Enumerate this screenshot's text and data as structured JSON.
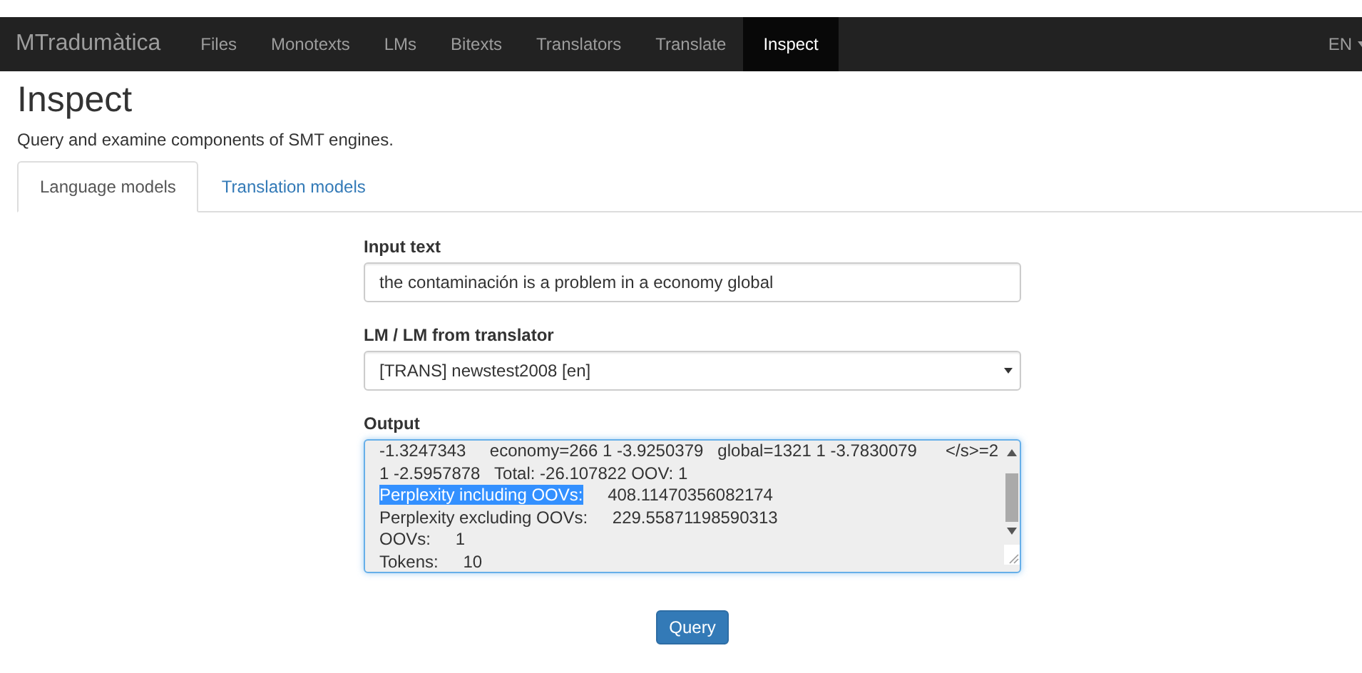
{
  "navbar": {
    "brand": "MTradumàtica",
    "items": [
      {
        "label": "Files",
        "selected": false
      },
      {
        "label": "Monotexts",
        "selected": false
      },
      {
        "label": "LMs",
        "selected": false
      },
      {
        "label": "Bitexts",
        "selected": false
      },
      {
        "label": "Translators",
        "selected": false
      },
      {
        "label": "Translate",
        "selected": false
      },
      {
        "label": "Inspect",
        "selected": true
      }
    ],
    "language": "EN"
  },
  "page": {
    "title": "Inspect",
    "subtitle": "Query and examine components of SMT engines."
  },
  "tabs": [
    {
      "label": "Language models",
      "selected": true
    },
    {
      "label": "Translation models",
      "selected": false
    }
  ],
  "form": {
    "input_label": "Input text",
    "input_value": "the contaminación is a problem in a economy global",
    "select_label": "LM / LM from translator",
    "select_value": "[TRANS] newstest2008 [en]",
    "output_label": "Output",
    "output_lines": [
      {
        "label": "-1.3247343     economy=266 1 -3.9250379   global=1321 1 -3.7830079      </s>=2",
        "selected": false
      },
      {
        "label": "1 -2.5957878   Total: -26.107822 OOV: 1",
        "selected": false
      },
      {
        "label": "Perplexity including OOVs:",
        "value": "408.11470356082174",
        "selected": true
      },
      {
        "label": "Perplexity excluding OOVs:",
        "value": "229.55871198590313",
        "selected": false
      },
      {
        "label": "OOVs:",
        "value": "1",
        "selected": false
      },
      {
        "label": "Tokens:",
        "value": "10",
        "selected": false
      }
    ],
    "button": "Query"
  }
}
